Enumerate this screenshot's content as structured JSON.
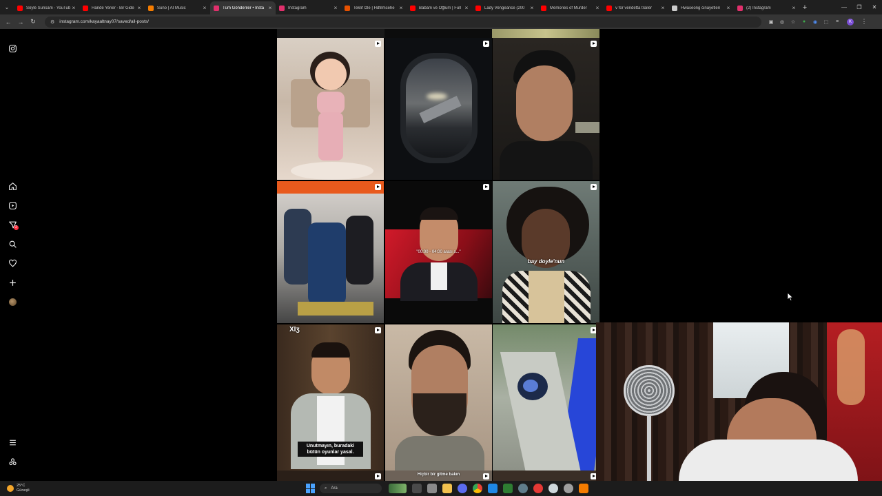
{
  "browser": {
    "tabs": [
      {
        "title": "Söyle Sunsam - YouTub",
        "favicon_color": "#ff0000",
        "active": false
      },
      {
        "title": "Hande Yener - Bir Gide",
        "favicon_color": "#ff0000",
        "active": false
      },
      {
        "title": "Suno | AI Music",
        "favicon_color": "#f57c00",
        "active": false
      },
      {
        "title": "Tüm Gönderiler • Insta",
        "favicon_color": "#e1306c",
        "active": true
      },
      {
        "title": "Instagram",
        "favicon_color": "#e1306c",
        "active": false
      },
      {
        "title": "Teklif İzle | Hdfilmcehe",
        "favicon_color": "#e65100",
        "active": false
      },
      {
        "title": "Babam ve Oğlum | Full",
        "favicon_color": "#ff0000",
        "active": false
      },
      {
        "title": "Lady Vengeance (200",
        "favicon_color": "#ff0000",
        "active": false
      },
      {
        "title": "Memories of Murder",
        "favicon_color": "#ff0000",
        "active": false
      },
      {
        "title": "v for vendetta trailer",
        "favicon_color": "#ff0000",
        "active": false
      },
      {
        "title": "Hwaseong cinayetleri",
        "favicon_color": "#cccccc",
        "active": false
      },
      {
        "title": "(2) Instagram",
        "favicon_color": "#e1306c",
        "active": false
      }
    ],
    "close_glyph": "×",
    "new_tab_glyph": "+",
    "menu_glyph": "⌄",
    "window_controls": [
      "—",
      "❐",
      "✕"
    ],
    "nav": {
      "back": "←",
      "forward": "→",
      "reload": "↻"
    },
    "url": "instagram.com/kayaaltnay07/saved/all-posts/",
    "tune_glyph": "⚙",
    "profile_initial": "K",
    "toolbar_icons": [
      "▣",
      "◎",
      "☆",
      "●",
      "◉",
      "⬚",
      "≡",
      "⋮"
    ]
  },
  "sidebar": {
    "logo": "instagram-icon",
    "items": [
      "home-icon",
      "reels-icon",
      "messages-icon",
      "search-icon",
      "heart-icon",
      "create-icon",
      "profile-avatar"
    ],
    "notification_count": "2",
    "bottom": [
      "menu-icon",
      "threads-icon"
    ]
  },
  "feed": {
    "tiles": [
      {
        "kind": "baby"
      },
      {
        "kind": "airplane-window"
      },
      {
        "kind": "man-portrait"
      },
      {
        "kind": "hospital-scene"
      },
      {
        "kind": "red-stage-man",
        "overlay": "\"00:00 - 04:00 arası s...\""
      },
      {
        "kind": "woman-glasses",
        "overlay": "bay doyle'nun"
      },
      {
        "kind": "man-talking",
        "top_text": "XIӡ",
        "caption": "Unutmayın, buradaki bütün oyunlar yasal."
      },
      {
        "kind": "bearded-man"
      },
      {
        "kind": "motorbike"
      }
    ],
    "partial_caption": "Hiçbir bir gitme bakın"
  },
  "taskbar": {
    "temperature": "25°C",
    "condition": "Güneşli",
    "search_label": "Ara"
  }
}
